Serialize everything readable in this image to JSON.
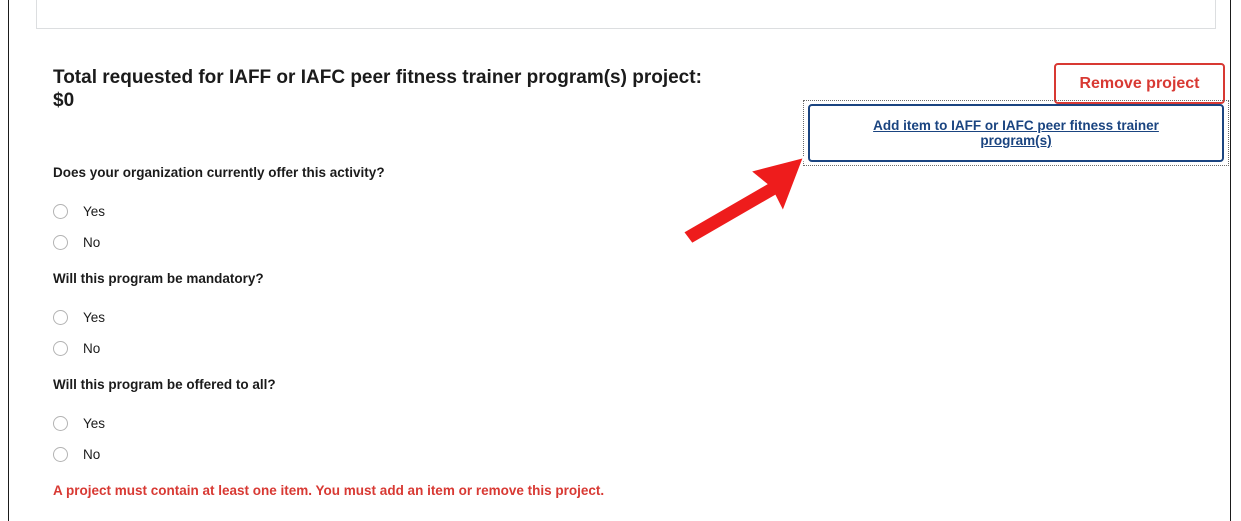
{
  "project": {
    "title": "Total requested for IAFF or IAFC peer fitness trainer program(s) project:",
    "amount": "$0"
  },
  "buttons": {
    "remove_project": "Remove project",
    "add_item": "Add item to IAFF or IAFC peer fitness trainer program(s)"
  },
  "questions": [
    {
      "text": "Does your organization currently offer this activity?",
      "options": [
        "Yes",
        "No"
      ]
    },
    {
      "text": "Will this program be mandatory?",
      "options": [
        "Yes",
        "No"
      ]
    },
    {
      "text": "Will this program be offered to all?",
      "options": [
        "Yes",
        "No"
      ]
    }
  ],
  "error": "A project must contain at least one item. You must add an item or remove this project.",
  "colors": {
    "accent": "#1a4480",
    "error": "#d83933",
    "arrow": "#ee1c1c"
  },
  "icons": {
    "annotation": "red-arrow-icon"
  }
}
